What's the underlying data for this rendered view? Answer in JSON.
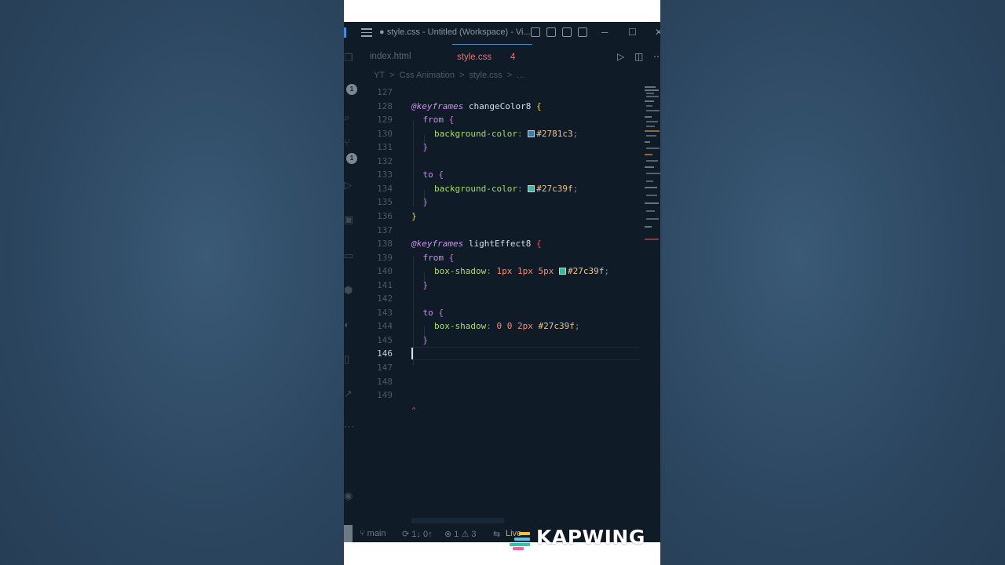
{
  "window": {
    "title": "● style.css - Untitled (Workspace) - Vi..."
  },
  "tabs": [
    {
      "label": "index.html",
      "active": false
    },
    {
      "label": "style.css",
      "active": true,
      "problems": "4"
    }
  ],
  "breadcrumb": [
    "YT",
    ">",
    "Css Animation",
    ">",
    "style.css",
    ">",
    "..."
  ],
  "activity_badges": [
    "1",
    "1"
  ],
  "editor": {
    "active_line": "146",
    "lines": [
      {
        "n": "127"
      },
      {
        "n": "128",
        "at": "@keyframes",
        "name": " changeColor8 ",
        "open": "{"
      },
      {
        "n": "129",
        "sel": "from",
        "open": " {"
      },
      {
        "n": "130",
        "prop": "background-color",
        "colon": ": ",
        "swatch": "#2781c3",
        "hex": "#2781c3",
        "semi": ";"
      },
      {
        "n": "131",
        "close": "}"
      },
      {
        "n": "132"
      },
      {
        "n": "133",
        "sel": "to",
        "open": " {"
      },
      {
        "n": "134",
        "prop": "background-color",
        "colon": ": ",
        "swatch": "#27c39f",
        "hex": "#27c39f",
        "semi": ";"
      },
      {
        "n": "135",
        "close": "}"
      },
      {
        "n": "136",
        "close": "}"
      },
      {
        "n": "137"
      },
      {
        "n": "138",
        "at": "@keyframes",
        "name": " lightEffect8 ",
        "open": "{"
      },
      {
        "n": "139",
        "sel": "from",
        "open": " {"
      },
      {
        "n": "140",
        "prop": "box-shadow",
        "colon": ": ",
        "nums": "1px 1px 5px ",
        "swatch": "#27c39f",
        "hex": "#27c39f",
        "semi": ";"
      },
      {
        "n": "141",
        "close": "}"
      },
      {
        "n": "142"
      },
      {
        "n": "143",
        "sel": "to",
        "open": " {"
      },
      {
        "n": "144",
        "prop": "box-shadow",
        "colon": ": ",
        "nums": "0 0 2px ",
        "hex": "#27c39f",
        "semi": ";"
      },
      {
        "n": "145",
        "close": "}"
      },
      {
        "n": "146"
      },
      {
        "n": "147"
      },
      {
        "n": "148"
      },
      {
        "n": "149"
      }
    ]
  },
  "status": {
    "branch": "main",
    "sync": "1↓ 0↑",
    "errors": "1",
    "warnings": "3",
    "live": "Live"
  },
  "watermark": "KAPWING",
  "colors": {
    "editor_bg": "#0f1b26",
    "swatch_blue": "#2781c3",
    "swatch_green": "#27c39f",
    "tab_error": "#e57373"
  }
}
